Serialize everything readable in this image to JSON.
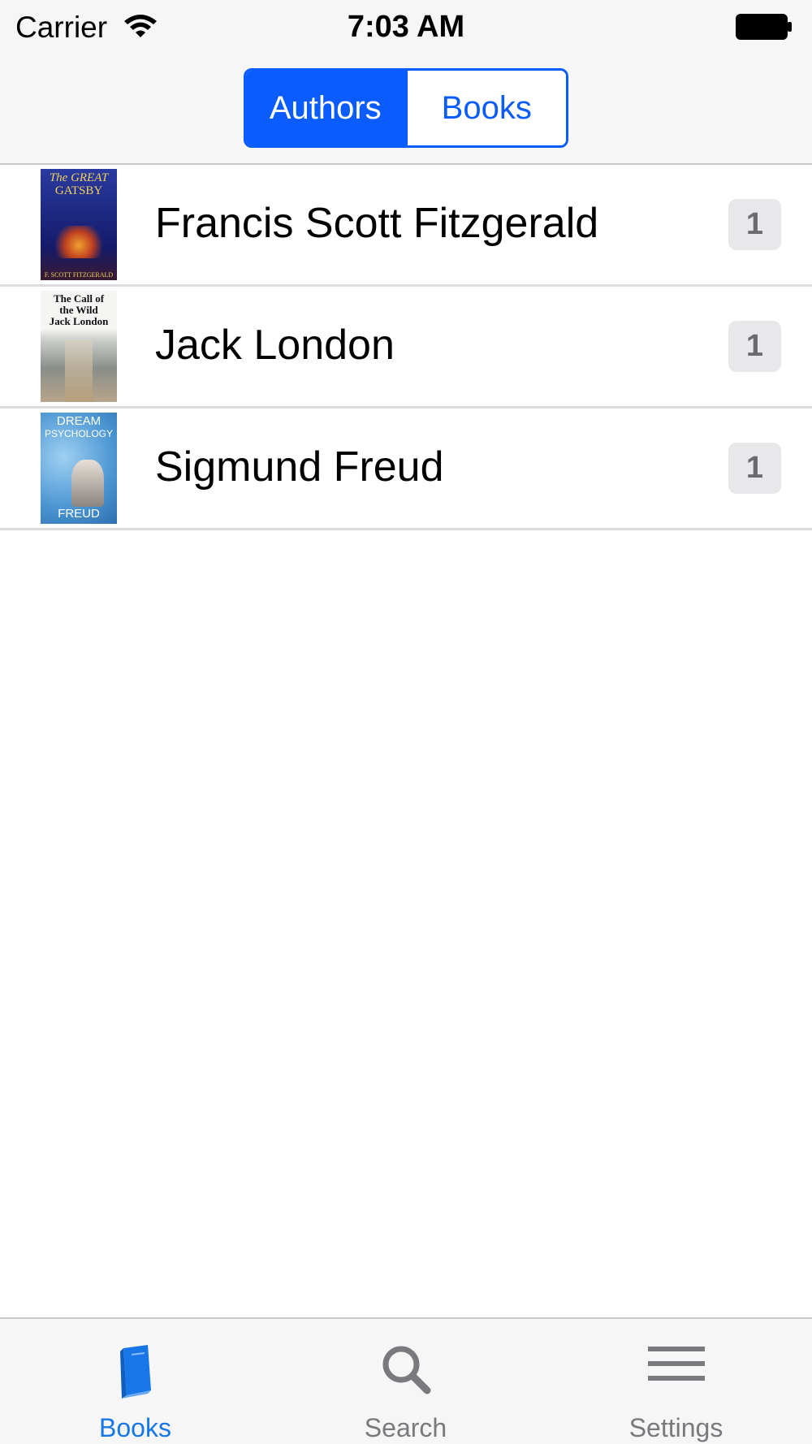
{
  "status_bar": {
    "carrier": "Carrier",
    "time": "7:03 AM"
  },
  "segmented_control": {
    "segments": [
      {
        "label": "Authors",
        "selected": true
      },
      {
        "label": "Books",
        "selected": false
      }
    ]
  },
  "authors": [
    {
      "name": "Francis Scott Fitzgerald",
      "count": "1",
      "cover": {
        "title_top": "The GREAT",
        "title_bottom": "GATSBY",
        "author": "F. SCOTT FITZGERALD",
        "colors": [
          "#2a3aa0",
          "#0e1450"
        ]
      }
    },
    {
      "name": "Jack London",
      "count": "1",
      "cover": {
        "title_top": "The Call of",
        "title_bottom": "the Wild",
        "author": "Jack London",
        "colors": [
          "#f4f4f2",
          "#8a8d8c"
        ]
      }
    },
    {
      "name": "Sigmund Freud",
      "count": "1",
      "cover": {
        "title_top": "DREAM",
        "title_bottom": "PSYCHOLOGY",
        "author": "FREUD",
        "colors": [
          "#5aa6dc",
          "#2f6fb0"
        ]
      }
    }
  ],
  "tab_bar": {
    "tabs": [
      {
        "label": "Books",
        "icon": "book-icon",
        "selected": true
      },
      {
        "label": "Search",
        "icon": "search-icon",
        "selected": false
      },
      {
        "label": "Settings",
        "icon": "menu-icon",
        "selected": false
      }
    ]
  },
  "colors": {
    "accent": "#0b5cff",
    "tab_selected": "#1877e8",
    "tab_unselected": "#7a7a7e",
    "separator": "#dcdcdf",
    "bar_background": "#f6f6f7"
  }
}
